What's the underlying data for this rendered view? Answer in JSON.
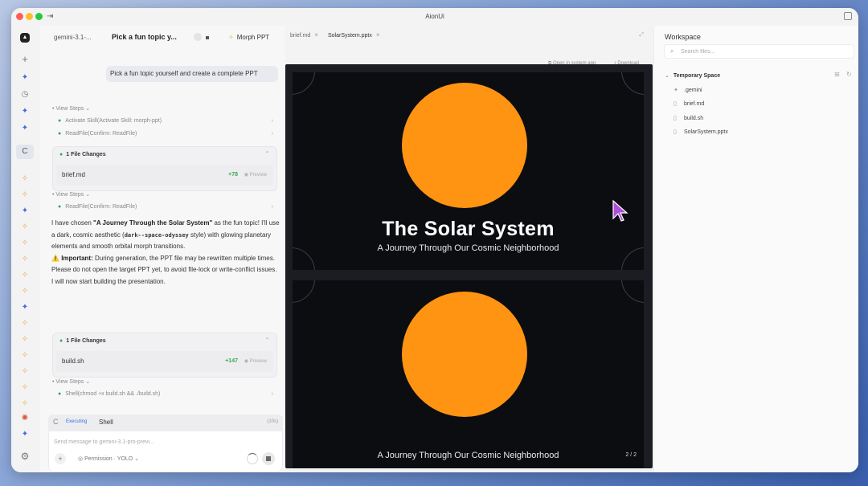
{
  "window": {
    "title": "AionUi"
  },
  "rail": {
    "items": [
      "logo-icon",
      "plus-icon",
      "sparkle-icon",
      "clock-icon",
      "sparkle-icon",
      "sparkle-icon",
      "loading-icon",
      "sparkle-icon",
      "sparkle-icon",
      "sparkle-icon",
      "sparkle-icon",
      "sparkle-icon",
      "sparkle-icon",
      "sparkle-icon",
      "sparkle-icon",
      "sparkle-icon",
      "sparkle-icon",
      "sparkle-icon",
      "sparkle-icon",
      "sparkle-icon",
      "settings-icon"
    ]
  },
  "conversation": {
    "model": "gemini-3.1-...",
    "title": "Pick a fun topic y...",
    "agent": "Morph PPT",
    "user_message": "Pick a fun topic yourself and create a complete PPT",
    "view_steps_label": "View Steps",
    "steps_group_1": [
      "Activate Skill(Activate Skill: morph-ppt)",
      "ReadFile(Confirm: ReadFile)"
    ],
    "file_changes_1": {
      "title": "1 File Changes",
      "file": "brief.md",
      "additions": "+78",
      "preview": "Preview"
    },
    "steps_group_2": [
      "ReadFile(Confirm: ReadFile)"
    ],
    "message": {
      "p1_a": "I have chosen ",
      "p1_b": "\"A Journey Through the Solar System\"",
      "p1_c": " as the fun topic! I'll use a dark, cosmic aesthetic (",
      "p1_code": "dark--space-odyssey",
      "p1_d": " style) with glowing planetary elements and smooth orbital morph transitions.",
      "warn_icon": "⚠️",
      "warn_label": "Important:",
      "warn_text": " During generation, the PPT file may be rewritten multiple times. Please do not open the target PPT yet, to avoid file-lock or write-conflict issues.",
      "p3": "I will now start building the presentation."
    },
    "file_changes_2": {
      "title": "1 File Changes",
      "file": "build.sh",
      "additions": "+147",
      "preview": "Preview"
    },
    "steps_group_3": [
      "Shell(chmod +x build.sh && ./build.sh)"
    ],
    "executing": {
      "label": "Executing",
      "tool": "Shell",
      "time": "(10s)"
    },
    "composer": {
      "placeholder": "Send message to gemini-3.1-pro-previ...",
      "permission": "Permission · YOLO"
    }
  },
  "preview": {
    "tabs": [
      "brief.md",
      "SolarSystem.pptx"
    ],
    "open_in_system": "Open in system app",
    "download": "Download",
    "slide1": {
      "title": "The Solar System",
      "subtitle": "A Journey Through Our Cosmic Neighborhood"
    },
    "slide2": {
      "subtitle": "A Journey Through Our Cosmic Neighborhood",
      "page": "2 / 2"
    },
    "colors": {
      "sun": "#ff9413",
      "slide_bg": "#0c0d11",
      "cursor": "#b04fd8"
    }
  },
  "workspace": {
    "title": "Workspace",
    "search_placeholder": "Search files...",
    "root": "Temporary Space",
    "files": [
      ".gemini",
      "brief.md",
      "build.sh",
      "SolarSystem.pptx"
    ]
  }
}
